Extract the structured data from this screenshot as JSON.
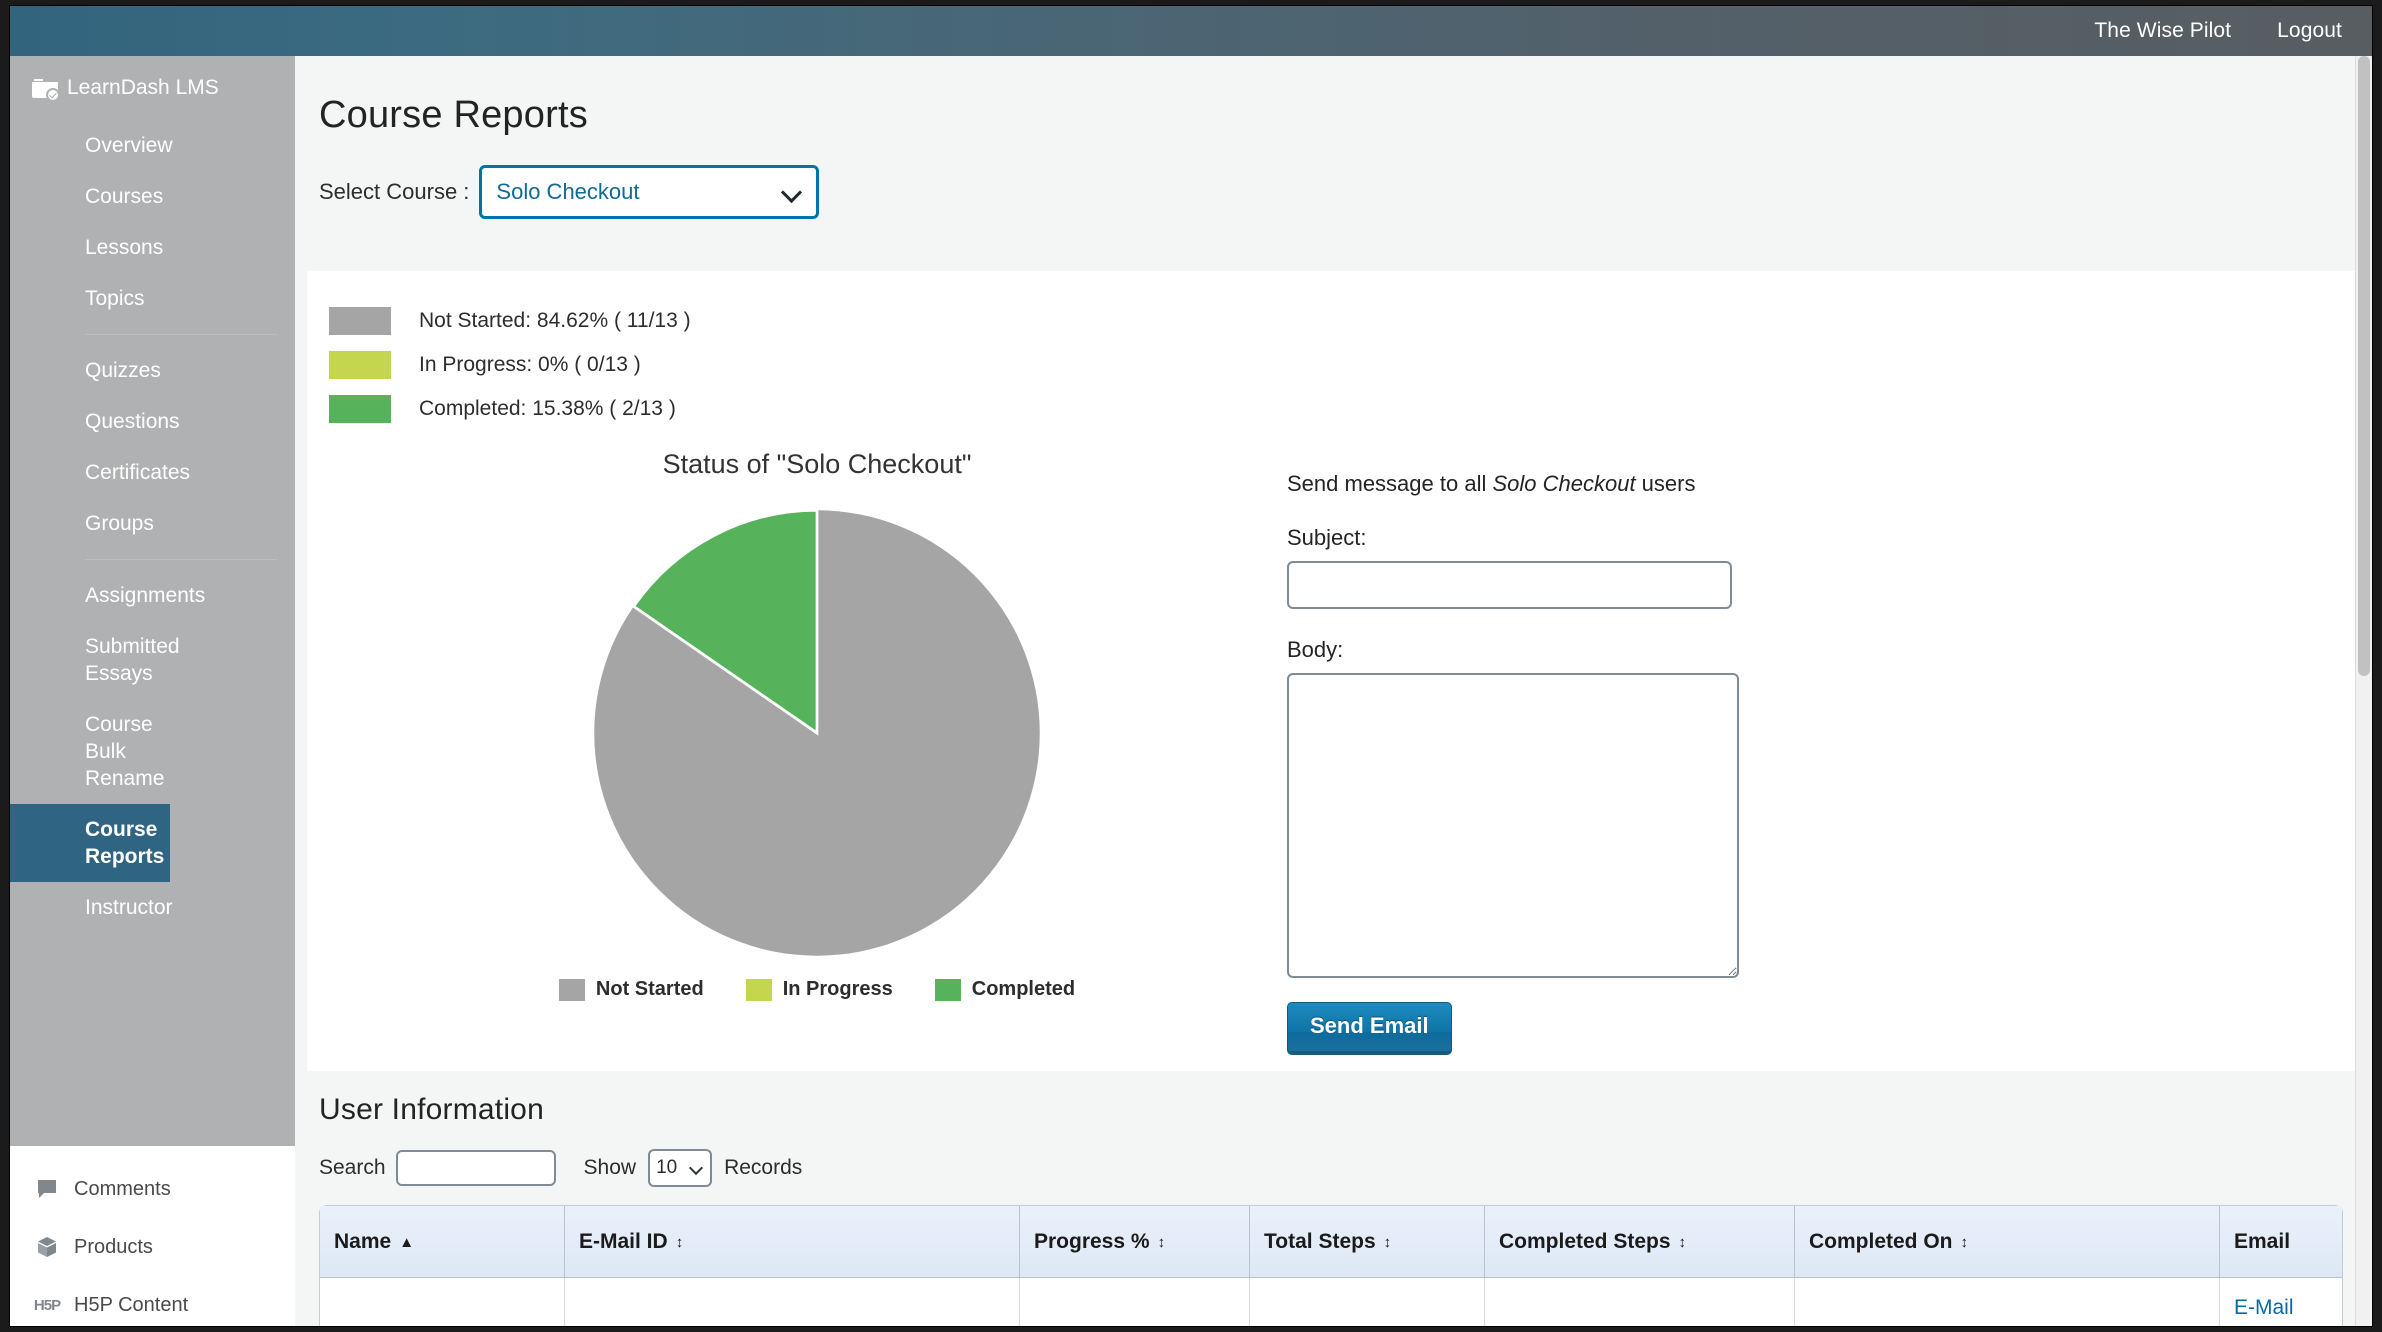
{
  "adminbar": {
    "user_label": "The Wise Pilot",
    "logout_label": "Logout"
  },
  "sidebar": {
    "brand": "LearnDash LMS",
    "brand_icon": "learndash-logo-icon",
    "items": [
      {
        "label": "Overview",
        "active": false
      },
      {
        "label": "Courses",
        "active": false
      },
      {
        "label": "Lessons",
        "active": false
      },
      {
        "label": "Topics",
        "active": false
      },
      {
        "label": "Quizzes",
        "active": false
      },
      {
        "label": "Questions",
        "active": false
      },
      {
        "label": "Certificates",
        "active": false
      },
      {
        "label": "Groups",
        "active": false
      },
      {
        "label": "Assignments",
        "active": false
      },
      {
        "label": "Submitted Essays",
        "active": false
      },
      {
        "label": "Course Bulk Rename",
        "active": false
      },
      {
        "label": "Course Reports",
        "active": true
      },
      {
        "label": "Instructor",
        "active": false
      }
    ],
    "wp_items": [
      {
        "label": "Comments",
        "icon": "comment-icon"
      },
      {
        "label": "Products",
        "icon": "products-box-icon"
      },
      {
        "label": "H5P Content",
        "icon": "h5p-icon"
      }
    ]
  },
  "page": {
    "title": "Course Reports",
    "select_course_label": "Select Course :",
    "selected_course": "Solo Checkout",
    "select_chevron_icon": "chevron-down-icon"
  },
  "status": {
    "rows": [
      {
        "label": "Not Started: 84.62% ( 11/13 )",
        "color": "#a5a5a5"
      },
      {
        "label": "In Progress: 0% ( 0/13 )",
        "color": "#c4d64e"
      },
      {
        "label": "Completed: 15.38% ( 2/13 )",
        "color": "#57b35b"
      }
    ]
  },
  "chart_data": {
    "type": "pie",
    "title": "Status of \"Solo Checkout\"",
    "categories": [
      "Not Started",
      "In Progress",
      "Completed"
    ],
    "values": [
      84.62,
      0,
      15.38
    ],
    "counts": [
      11,
      0,
      2
    ],
    "total": 13,
    "colors": [
      "#a5a5a5",
      "#c4d64e",
      "#57b35b"
    ],
    "legend_position": "bottom",
    "start_angle_deg": 0,
    "direction": "counterclockwise",
    "xlabel": "",
    "ylabel": ""
  },
  "mail": {
    "heading_prefix": "Send message to all ",
    "heading_course": "Solo Checkout",
    "heading_suffix": " users",
    "subject_label": "Subject:",
    "subject_value": "",
    "subject_placeholder": "",
    "body_label": "Body:",
    "body_value": "",
    "body_placeholder": "",
    "send_label": "Send Email"
  },
  "userinfo": {
    "title": "User Information",
    "search_label": "Search",
    "search_value": "",
    "search_placeholder": "",
    "show_label": "Show",
    "show_value": "10",
    "records_label": "Records",
    "show_chevron_icon": "chevron-down-icon",
    "columns": [
      {
        "label": "Name",
        "sort": "asc"
      },
      {
        "label": "E-Mail ID",
        "sort": "both"
      },
      {
        "label": "Progress %",
        "sort": "both"
      },
      {
        "label": "Total Steps",
        "sort": "both"
      },
      {
        "label": "Completed Steps",
        "sort": "both"
      },
      {
        "label": "Completed On",
        "sort": "both"
      },
      {
        "label": "Email",
        "sort": "none"
      }
    ],
    "rows": [
      {
        "name": "",
        "email_id": "",
        "progress": "",
        "total_steps": "",
        "completed_steps": "",
        "completed_on": "",
        "email_link": "E-Mail"
      }
    ]
  }
}
